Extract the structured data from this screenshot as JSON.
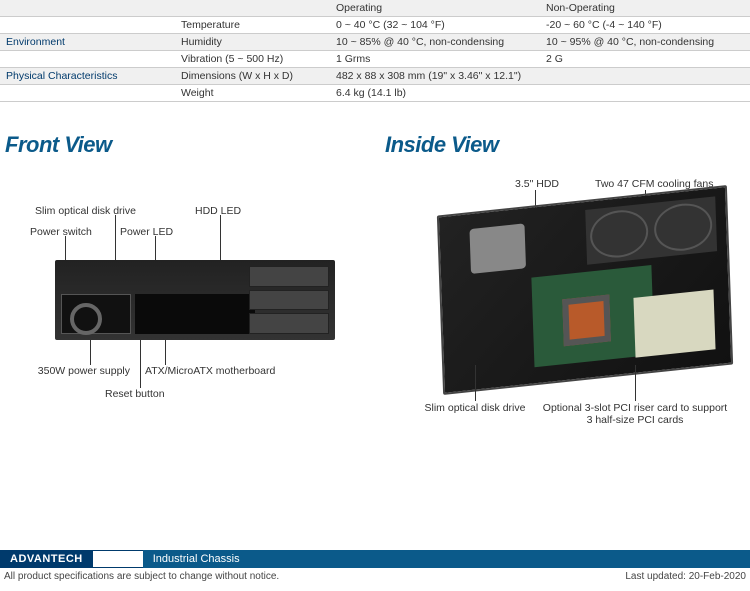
{
  "table": {
    "headers": {
      "h1": "Operating",
      "h2": "Non-Operating"
    },
    "rows": [
      {
        "cat": "",
        "sub": "Temperature",
        "v1": "0 ~ 40 °C (32 ~ 104 °F)",
        "v2": "-20 ~ 60 °C (-4 ~ 140 °F)"
      },
      {
        "cat": "Environment",
        "sub": "Humidity",
        "v1": "10 ~ 85% @ 40 °C, non-condensing",
        "v2": "10 ~ 95% @ 40 °C, non-condensing"
      },
      {
        "cat": "",
        "sub": "Vibration (5 ~ 500 Hz)",
        "v1": "1 Grms",
        "v2": "2 G"
      },
      {
        "cat": "Physical Characteristics",
        "sub": "Dimensions (W x H x D)",
        "v1": "482 x 88 x 308 mm (19\" x 3.46\" x 12.1\")",
        "v2": ""
      },
      {
        "cat": "",
        "sub": "Weight",
        "v1": "6.4 kg (14.1 lb)",
        "v2": ""
      }
    ]
  },
  "front": {
    "title": "Front View",
    "labels": {
      "slim": "Slim optical disk drive",
      "hdd_led": "HDD LED",
      "power_switch": "Power switch",
      "power_led": "Power LED",
      "psu": "350W power supply",
      "mb": "ATX/MicroATX motherboard",
      "reset": "Reset button"
    }
  },
  "inside": {
    "title": "Inside View",
    "labels": {
      "hdd": "3.5\" HDD",
      "fans": "Two 47 CFM cooling fans",
      "slim": "Slim optical disk drive",
      "riser": "Optional 3-slot PCI riser card to support 3 half-size PCI cards"
    }
  },
  "footer": {
    "brand": "ADVANTECH",
    "category": "Industrial Chassis",
    "disclaimer": "All product specifications are subject to change without notice.",
    "updated": "Last updated: 20-Feb-2020"
  }
}
